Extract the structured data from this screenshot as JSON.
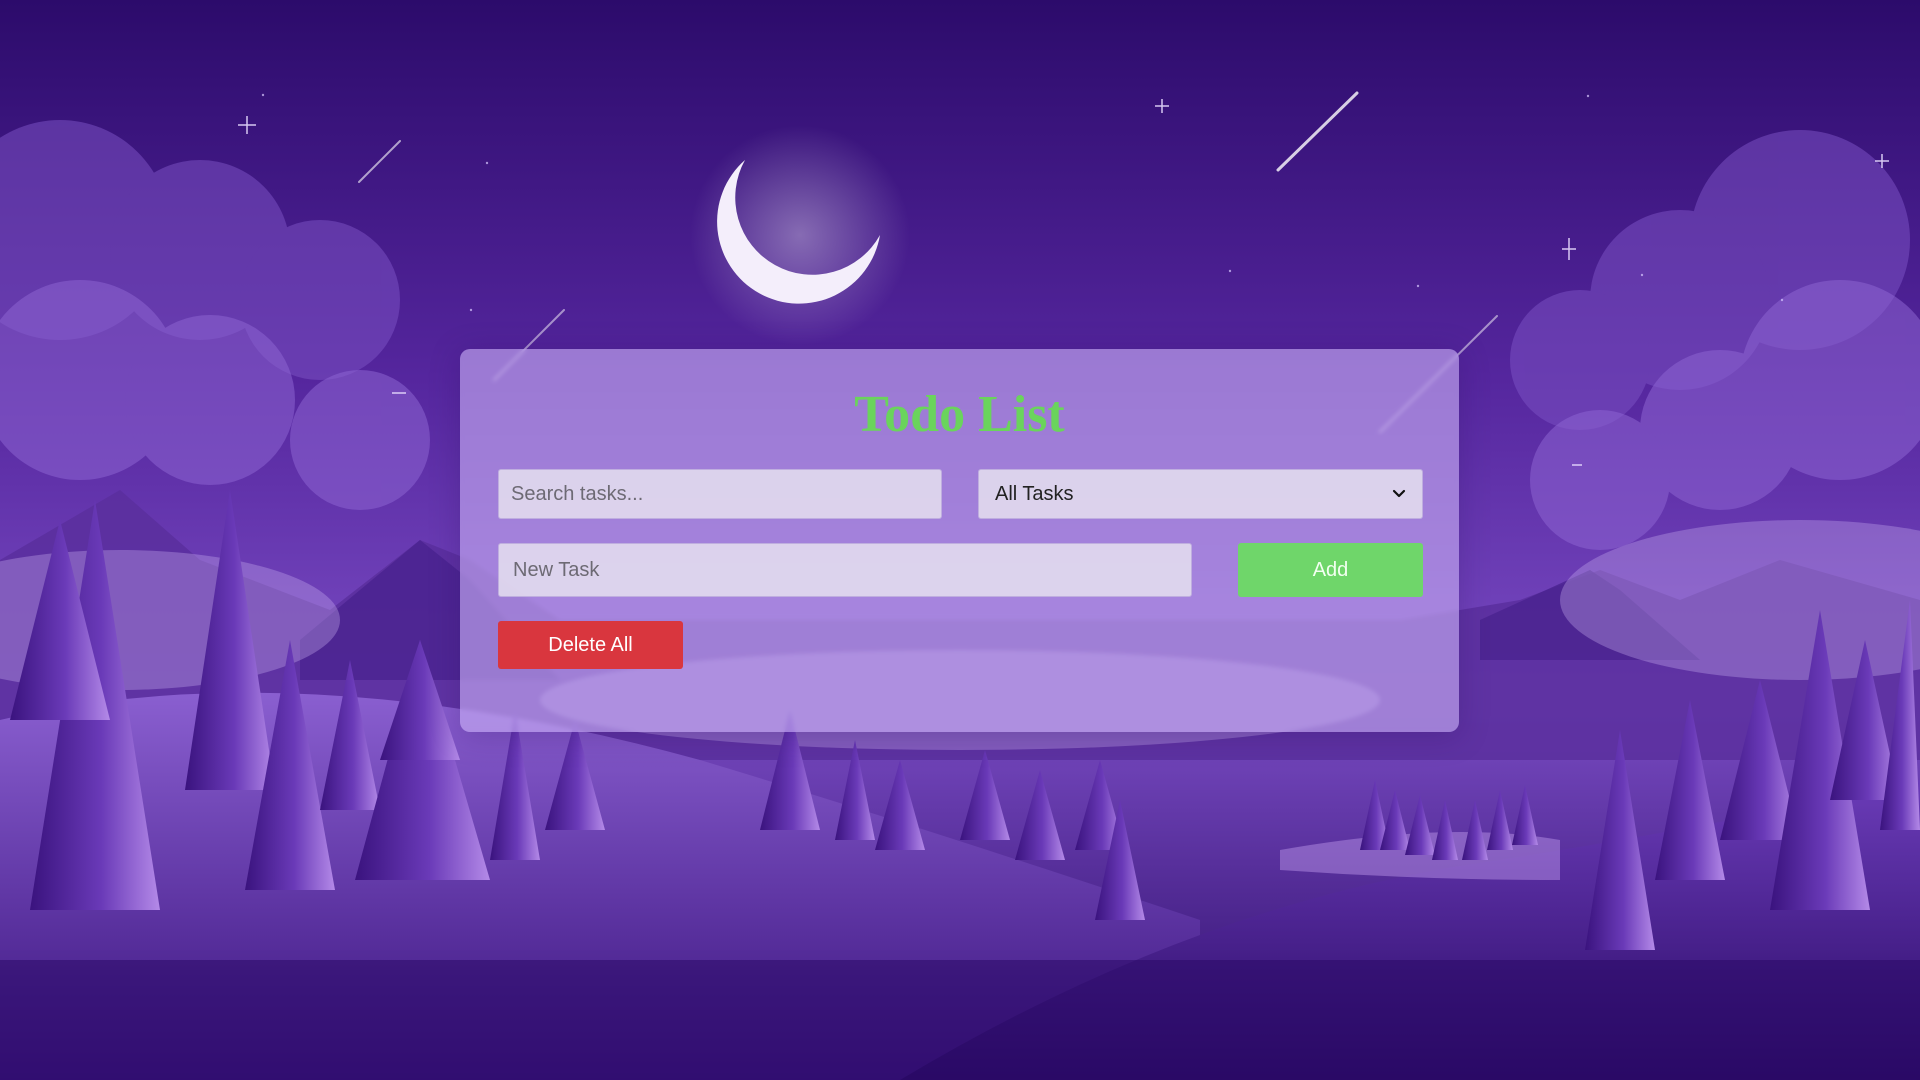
{
  "app": {
    "title": "Todo List"
  },
  "search": {
    "placeholder": "Search tasks...",
    "value": ""
  },
  "filter": {
    "selected": "All Tasks"
  },
  "new_task": {
    "placeholder": "New Task",
    "value": ""
  },
  "actions": {
    "add_label": "Add",
    "delete_all_label": "Delete All"
  },
  "colors": {
    "title": "#6ad45c",
    "add_button": "#6fd66a",
    "delete_button": "#d9363e",
    "sky_top": "#2c0b6b",
    "sky_mid": "#5a2ea6",
    "ground": "#2a0a66"
  },
  "icons": {
    "filter_dropdown": "chevron-down-icon",
    "moon": "crescent-moon-icon"
  }
}
